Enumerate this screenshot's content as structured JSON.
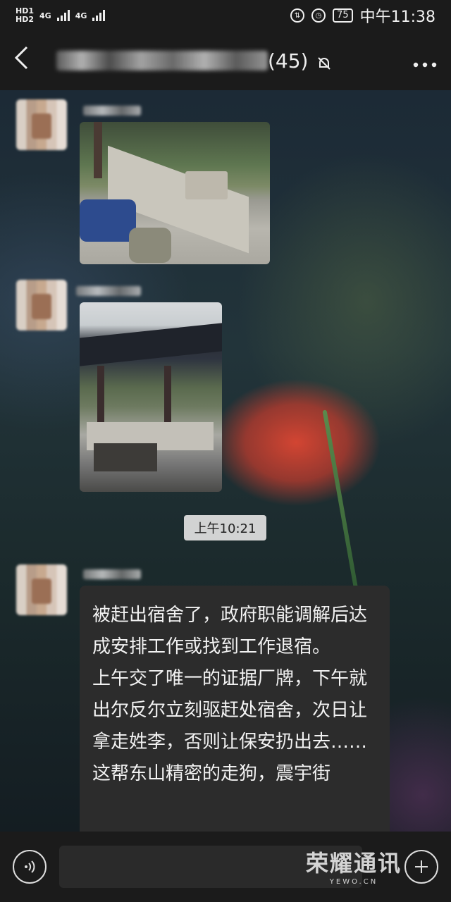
{
  "status_bar": {
    "network_labels": [
      "HD1",
      "HD2"
    ],
    "network_type_1": "4G",
    "network_type_2": "4G",
    "battery": "75",
    "time": "中午11:38"
  },
  "header": {
    "member_count": "(45)",
    "icons": {
      "back": "chevron-left-icon",
      "mute": "bell-off-icon",
      "more": "more-dots-icon"
    }
  },
  "messages": [
    {
      "type": "image",
      "description_icon": "photo"
    },
    {
      "type": "image",
      "description_icon": "photo"
    }
  ],
  "timestamp": "上午10:21",
  "text_message": {
    "paragraphs": [
      "被赶出宿舍了，政府职能调解后达成安排工作或找到工作退宿。",
      "上午交了唯一的证据厂牌，下午就出尔反尔立刻驱赶处宿舍，次日让拿走姓李，否则让保安扔出去……",
      "这帮东山精密的走狗，震宇街"
    ]
  },
  "bottom_bar": {
    "icons": {
      "voice": "voice-icon",
      "plus": "plus-icon"
    }
  },
  "watermark": {
    "line1": "荣耀通讯",
    "line2": "YEWO.CN"
  }
}
